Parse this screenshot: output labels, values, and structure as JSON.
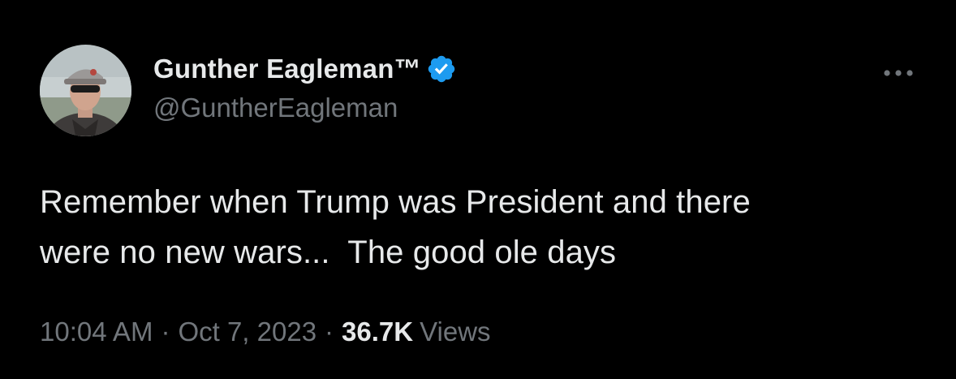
{
  "tweet": {
    "author": {
      "display_name": "Gunther Eagleman™",
      "handle": "@GuntherEagleman",
      "verified": true,
      "avatar_icon": "profile-photo"
    },
    "text": "Remember when Trump was President and there\nwere no new wars...  The good ole days",
    "meta": {
      "time": "10:04 AM",
      "separator": "·",
      "date": "Oct 7, 2023",
      "views_count": "36.7K",
      "views_label": "Views"
    }
  },
  "colors": {
    "background": "#000000",
    "primary_text": "#e7e9ea",
    "secondary_text": "#71767b",
    "verified_badge": "#1d9bf0"
  },
  "icons": {
    "verified": "verified-badge-icon",
    "more": "more-options-icon"
  }
}
